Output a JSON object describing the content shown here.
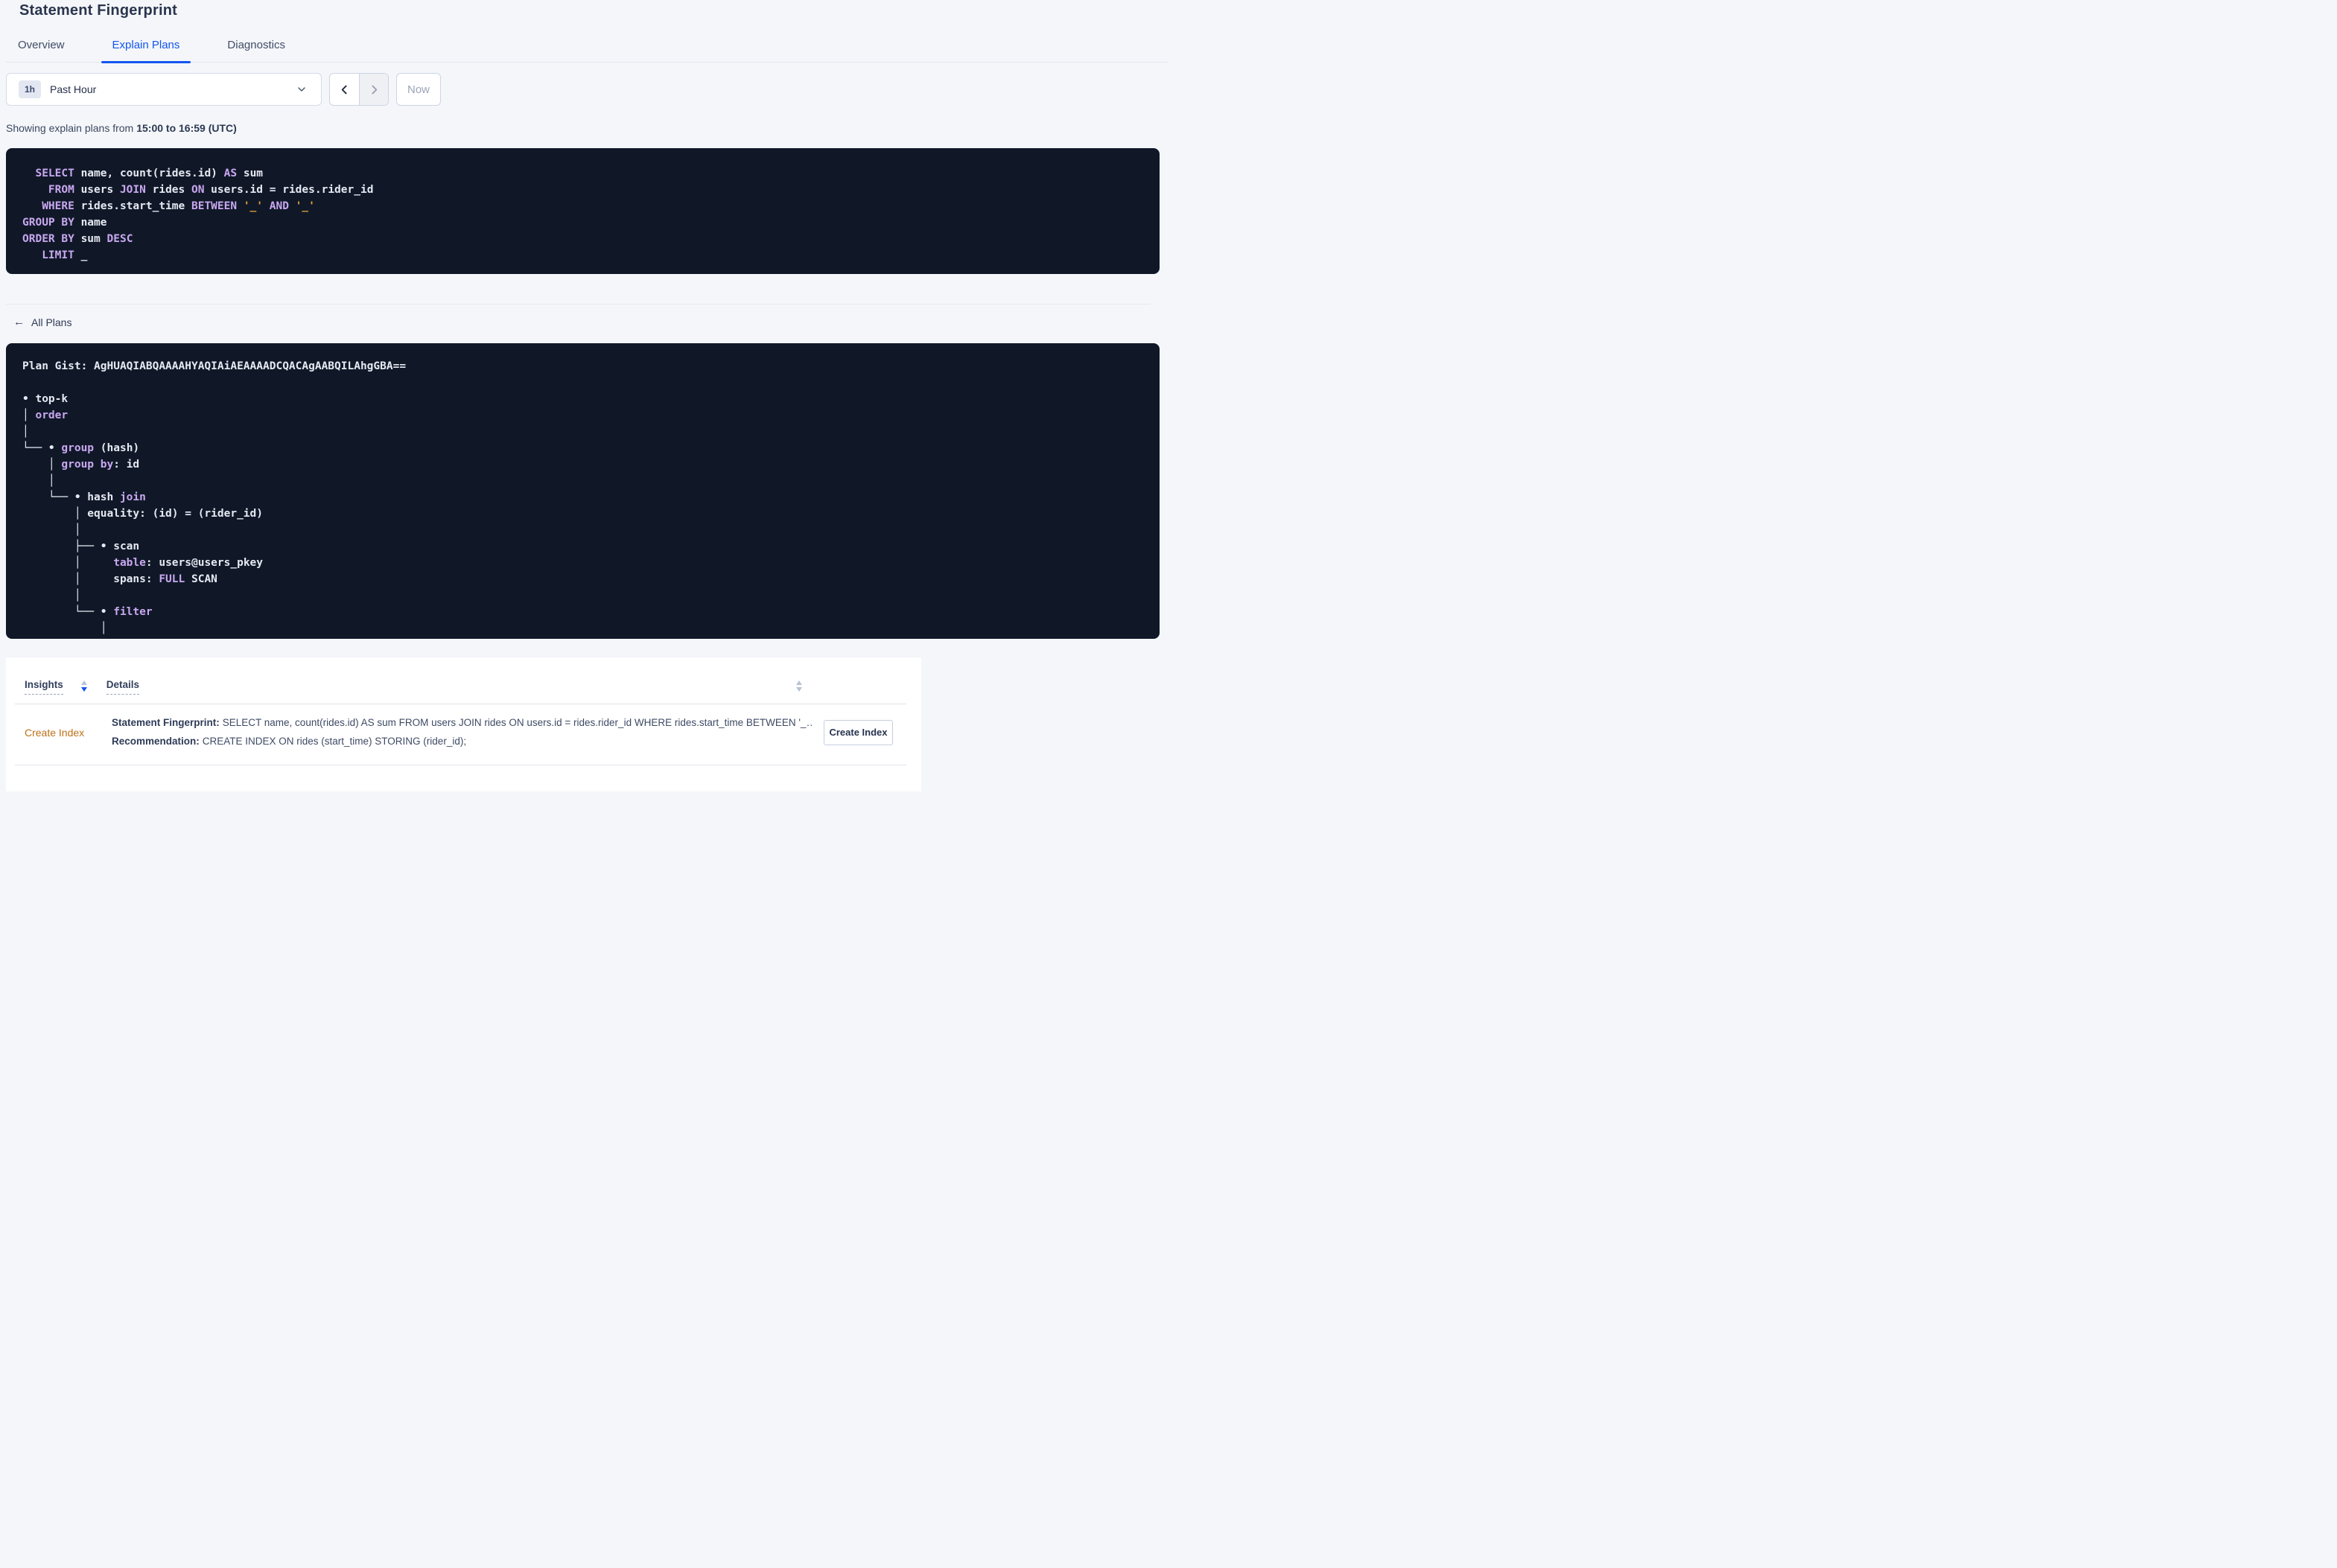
{
  "page": {
    "title": "Statement Fingerprint"
  },
  "tabs": {
    "overview": "Overview",
    "explain_plans": "Explain Plans",
    "diagnostics": "Diagnostics"
  },
  "time_controls": {
    "badge": "1h",
    "selected_range": "Past Hour",
    "now_label": "Now"
  },
  "caption": {
    "prefix": "Showing explain plans from",
    "bold_range": "15:00 to 16:59 (UTC)"
  },
  "sql_statement": {
    "lines": [
      [
        {
          "c": "k",
          "t": "  SELECT"
        },
        {
          "c": "t",
          "t": " name, count(rides.id) "
        },
        {
          "c": "k",
          "t": "AS"
        },
        {
          "c": "t",
          "t": " sum"
        }
      ],
      [
        {
          "c": "k",
          "t": "    FROM"
        },
        {
          "c": "t",
          "t": " users "
        },
        {
          "c": "k",
          "t": "JOIN"
        },
        {
          "c": "t",
          "t": " rides "
        },
        {
          "c": "k",
          "t": "ON"
        },
        {
          "c": "t",
          "t": " users.id = rides.rider_id"
        }
      ],
      [
        {
          "c": "k",
          "t": "   WHERE"
        },
        {
          "c": "t",
          "t": " rides.start_time "
        },
        {
          "c": "k",
          "t": "BETWEEN"
        },
        {
          "c": "t",
          "t": " "
        },
        {
          "c": "p",
          "t": "'_'"
        },
        {
          "c": "t",
          "t": " "
        },
        {
          "c": "k",
          "t": "AND"
        },
        {
          "c": "t",
          "t": " "
        },
        {
          "c": "p",
          "t": "'_'"
        }
      ],
      [
        {
          "c": "k",
          "t": "GROUP BY"
        },
        {
          "c": "t",
          "t": " name"
        }
      ],
      [
        {
          "c": "k",
          "t": "ORDER BY"
        },
        {
          "c": "t",
          "t": " sum "
        },
        {
          "c": "k",
          "t": "DESC"
        }
      ],
      [
        {
          "c": "k",
          "t": "   LIMIT"
        },
        {
          "c": "t",
          "t": " _"
        }
      ]
    ]
  },
  "nav": {
    "all_plans_label": "All Plans",
    "back_arrow": "←"
  },
  "plan_gist": {
    "lines": [
      [
        {
          "c": "t",
          "t": "Plan Gist: AgHUAQIABQAAAAHYAQIAiAEAAAADCQACAgAABQILAhgGBA=="
        }
      ],
      [
        {
          "c": "t",
          "t": ""
        }
      ],
      [
        {
          "c": "t",
          "t": "• top-k"
        }
      ],
      [
        {
          "c": "t",
          "t": "│ "
        },
        {
          "c": "k",
          "t": "order"
        }
      ],
      [
        {
          "c": "t",
          "t": "│"
        }
      ],
      [
        {
          "c": "t",
          "t": "└── • "
        },
        {
          "c": "k",
          "t": "group"
        },
        {
          "c": "t",
          "t": " (hash)"
        }
      ],
      [
        {
          "c": "t",
          "t": "    │ "
        },
        {
          "c": "k",
          "t": "group by"
        },
        {
          "c": "t",
          "t": ": id"
        }
      ],
      [
        {
          "c": "t",
          "t": "    │"
        }
      ],
      [
        {
          "c": "t",
          "t": "    └── • hash "
        },
        {
          "c": "k",
          "t": "join"
        }
      ],
      [
        {
          "c": "t",
          "t": "        │ equality: (id) = (rider_id)"
        }
      ],
      [
        {
          "c": "t",
          "t": "        │"
        }
      ],
      [
        {
          "c": "t",
          "t": "        ├── • scan"
        }
      ],
      [
        {
          "c": "t",
          "t": "        │     "
        },
        {
          "c": "k",
          "t": "table"
        },
        {
          "c": "t",
          "t": ": users@users_pkey"
        }
      ],
      [
        {
          "c": "t",
          "t": "        │     spans: "
        },
        {
          "c": "k",
          "t": "FULL"
        },
        {
          "c": "t",
          "t": " SCAN"
        }
      ],
      [
        {
          "c": "t",
          "t": "        │"
        }
      ],
      [
        {
          "c": "t",
          "t": "        └── • "
        },
        {
          "c": "k",
          "t": "filter"
        }
      ],
      [
        {
          "c": "t",
          "t": "            │"
        }
      ]
    ]
  },
  "insights": {
    "header": {
      "insights_col": "Insights",
      "details_col": "Details"
    },
    "row": {
      "insight_type": "Create Index",
      "statement_label": "Statement Fingerprint:",
      "statement_value": "SELECT name, count(rides.id) AS sum FROM users JOIN rides ON users.id = rides.rider_id WHERE rides.start_time BETWEEN '_…",
      "recommendation_label": "Recommendation:",
      "recommendation_value": "CREATE INDEX ON rides (start_time) STORING (rider_id);",
      "action_label": "Create Index"
    }
  },
  "colors": {
    "accent_blue": "#1356f0",
    "code_background": "#101828",
    "code_keyword": "#c9a8f0",
    "code_placeholder": "#e2a13d",
    "insight_orange": "#bd7117",
    "page_background": "#f4f6fa"
  }
}
